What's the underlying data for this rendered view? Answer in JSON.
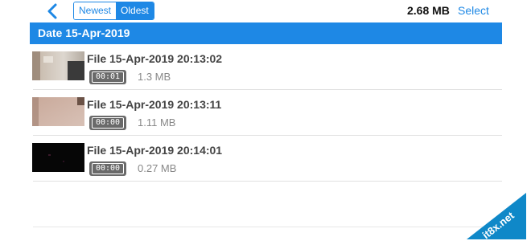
{
  "header": {
    "sort": {
      "newest": "Newest",
      "oldest": "Oldest",
      "selected": "Oldest"
    },
    "total_size": "2.68 MB",
    "select_label": "Select"
  },
  "section": {
    "title": "Date 15-Apr-2019"
  },
  "files": [
    {
      "name": "File 15-Apr-2019 20:13:02",
      "duration": "00:01",
      "size": "1.3 MB"
    },
    {
      "name": "File 15-Apr-2019 20:13:11",
      "duration": "00:00",
      "size": "1.11 MB"
    },
    {
      "name": "File 15-Apr-2019 20:14:01",
      "duration": "00:00",
      "size": "0.27 MB"
    }
  ],
  "watermark": {
    "text": "it8x.net"
  },
  "colors": {
    "accent": "#1e88e5"
  }
}
